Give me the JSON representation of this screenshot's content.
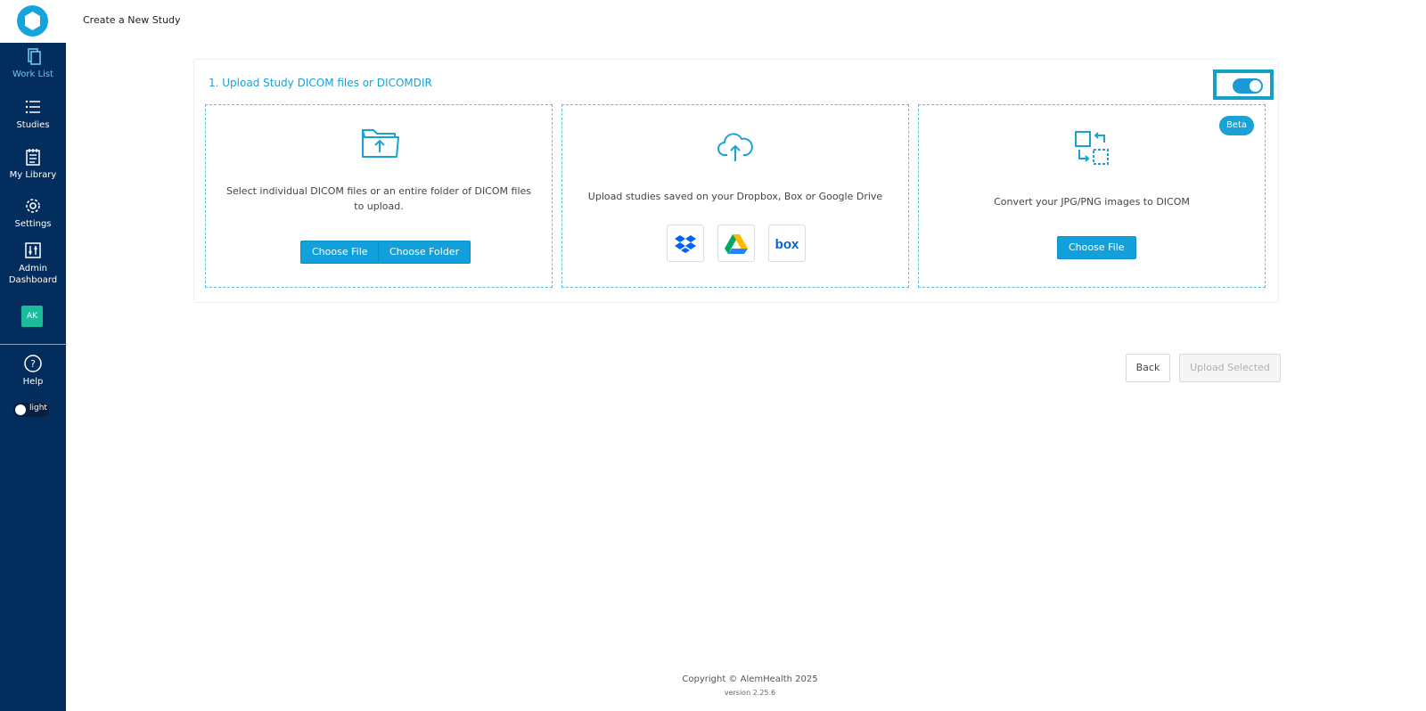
{
  "header": {
    "title": "Create a New Study"
  },
  "sidebar": {
    "items": [
      {
        "label": "Work List",
        "icon": "worklist-icon"
      },
      {
        "label": "Studies",
        "icon": "list-icon"
      },
      {
        "label": "My Library",
        "icon": "library-icon"
      },
      {
        "label": "Settings",
        "icon": "gear-icon"
      },
      {
        "label": "Admin Dashboard",
        "icon": "sliders-icon"
      }
    ],
    "avatar": "AK",
    "help": "Help",
    "theme_label": "light"
  },
  "upload": {
    "title": "1. Upload Study DICOM files or DICOMDIR",
    "local": {
      "text": "Select individual DICOM files or an entire folder of DICOM files to upload.",
      "choose_file": "Choose File",
      "choose_folder": "Choose Folder"
    },
    "cloud": {
      "text": "Upload studies saved on your Dropbox, Box or Google Drive",
      "services": [
        "Dropbox",
        "Google Drive",
        "box"
      ],
      "box_logo_text": "box"
    },
    "convert": {
      "badge": "Beta",
      "text": "Convert your JPG/PNG images to DICOM",
      "choose_file": "Choose File"
    }
  },
  "actions": {
    "back": "Back",
    "upload_selected": "Upload Selected"
  },
  "footer": {
    "copyright": "Copyright © AlemHealth 2025",
    "version": "version 2.25.6"
  },
  "colors": {
    "sidebar": "#032d5c",
    "accent": "#1aa1d6"
  }
}
